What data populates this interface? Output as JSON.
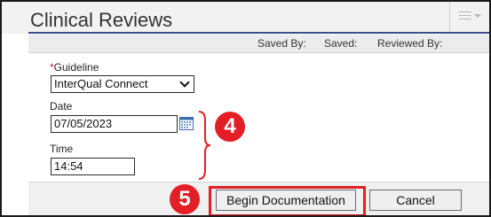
{
  "window": {
    "title": "Clinical Reviews",
    "menu_icon": "hamburger-menu-icon"
  },
  "status": {
    "saved_by": "Saved By:",
    "saved": "Saved:",
    "reviewed_by": "Reviewed By:"
  },
  "form": {
    "guideline": {
      "required_mark": "*",
      "label": "Guideline",
      "value": "InterQual Connect"
    },
    "date": {
      "label": "Date",
      "value": "07/05/2023",
      "icon": "calendar-icon"
    },
    "time": {
      "label": "Time",
      "value": "14:54"
    }
  },
  "callouts": {
    "step4": "4",
    "step5": "5",
    "color": "#e31e24"
  },
  "footer": {
    "begin_label": "Begin Documentation",
    "cancel_label": "Cancel"
  }
}
